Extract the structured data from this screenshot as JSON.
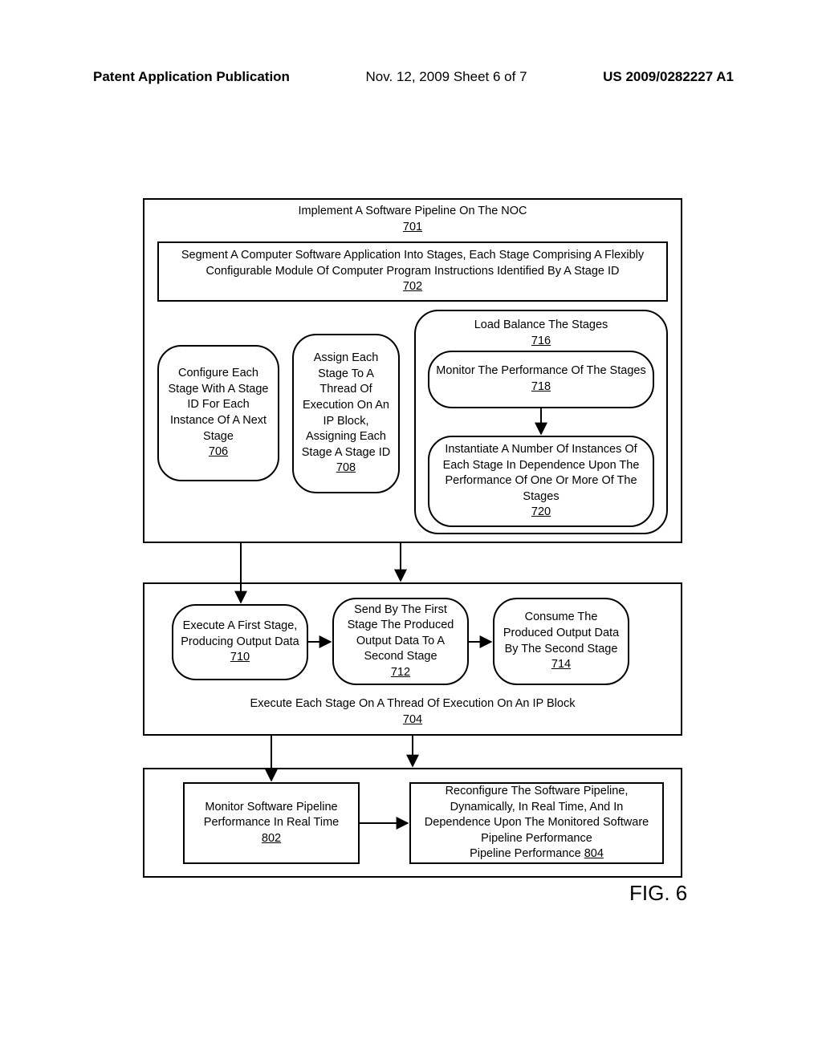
{
  "header": {
    "left": "Patent Application Publication",
    "mid": "Nov. 12, 2009  Sheet 6 of 7",
    "right": "US 2009/0282227 A1"
  },
  "fig_label": "FIG. 6",
  "box701": {
    "text": "Implement A Software Pipeline On The NOC",
    "ref": "701"
  },
  "box702": {
    "text": "Segment A Computer Software Application Into Stages, Each Stage Comprising A Flexibly Configurable Module Of Computer Program Instructions Identified By A Stage ID",
    "ref": "702"
  },
  "box706": {
    "text": "Configure Each Stage With A Stage ID For Each Instance Of A Next Stage",
    "ref": "706"
  },
  "box708": {
    "text": "Assign Each Stage To A Thread Of Execution On An IP Block, Assigning Each Stage A Stage ID",
    "ref": "708"
  },
  "box716": {
    "text": "Load Balance The Stages",
    "ref": "716"
  },
  "box718": {
    "text": "Monitor The Performance Of The Stages",
    "ref": "718"
  },
  "box720": {
    "text": "Instantiate A Number Of Instances Of Each Stage In Dependence Upon The Performance Of One Or More Of The Stages",
    "ref": "720"
  },
  "box710": {
    "text": "Execute A First Stage, Producing Output Data",
    "ref": "710"
  },
  "box712": {
    "text": "Send By The First Stage The Produced Output Data To A Second Stage",
    "ref": "712"
  },
  "box714": {
    "text": "Consume The Produced Output Data By The Second Stage",
    "ref": "714"
  },
  "box704": {
    "text": "Execute Each Stage On A Thread Of Execution On An IP Block",
    "ref": "704"
  },
  "box802": {
    "text": "Monitor Software Pipeline Performance In Real Time",
    "ref": "802"
  },
  "box804": {
    "text": "Reconfigure The Software Pipeline, Dynamically, In Real Time, And In Dependence Upon The Monitored Software Pipeline Performance",
    "ref_inline": "804"
  }
}
